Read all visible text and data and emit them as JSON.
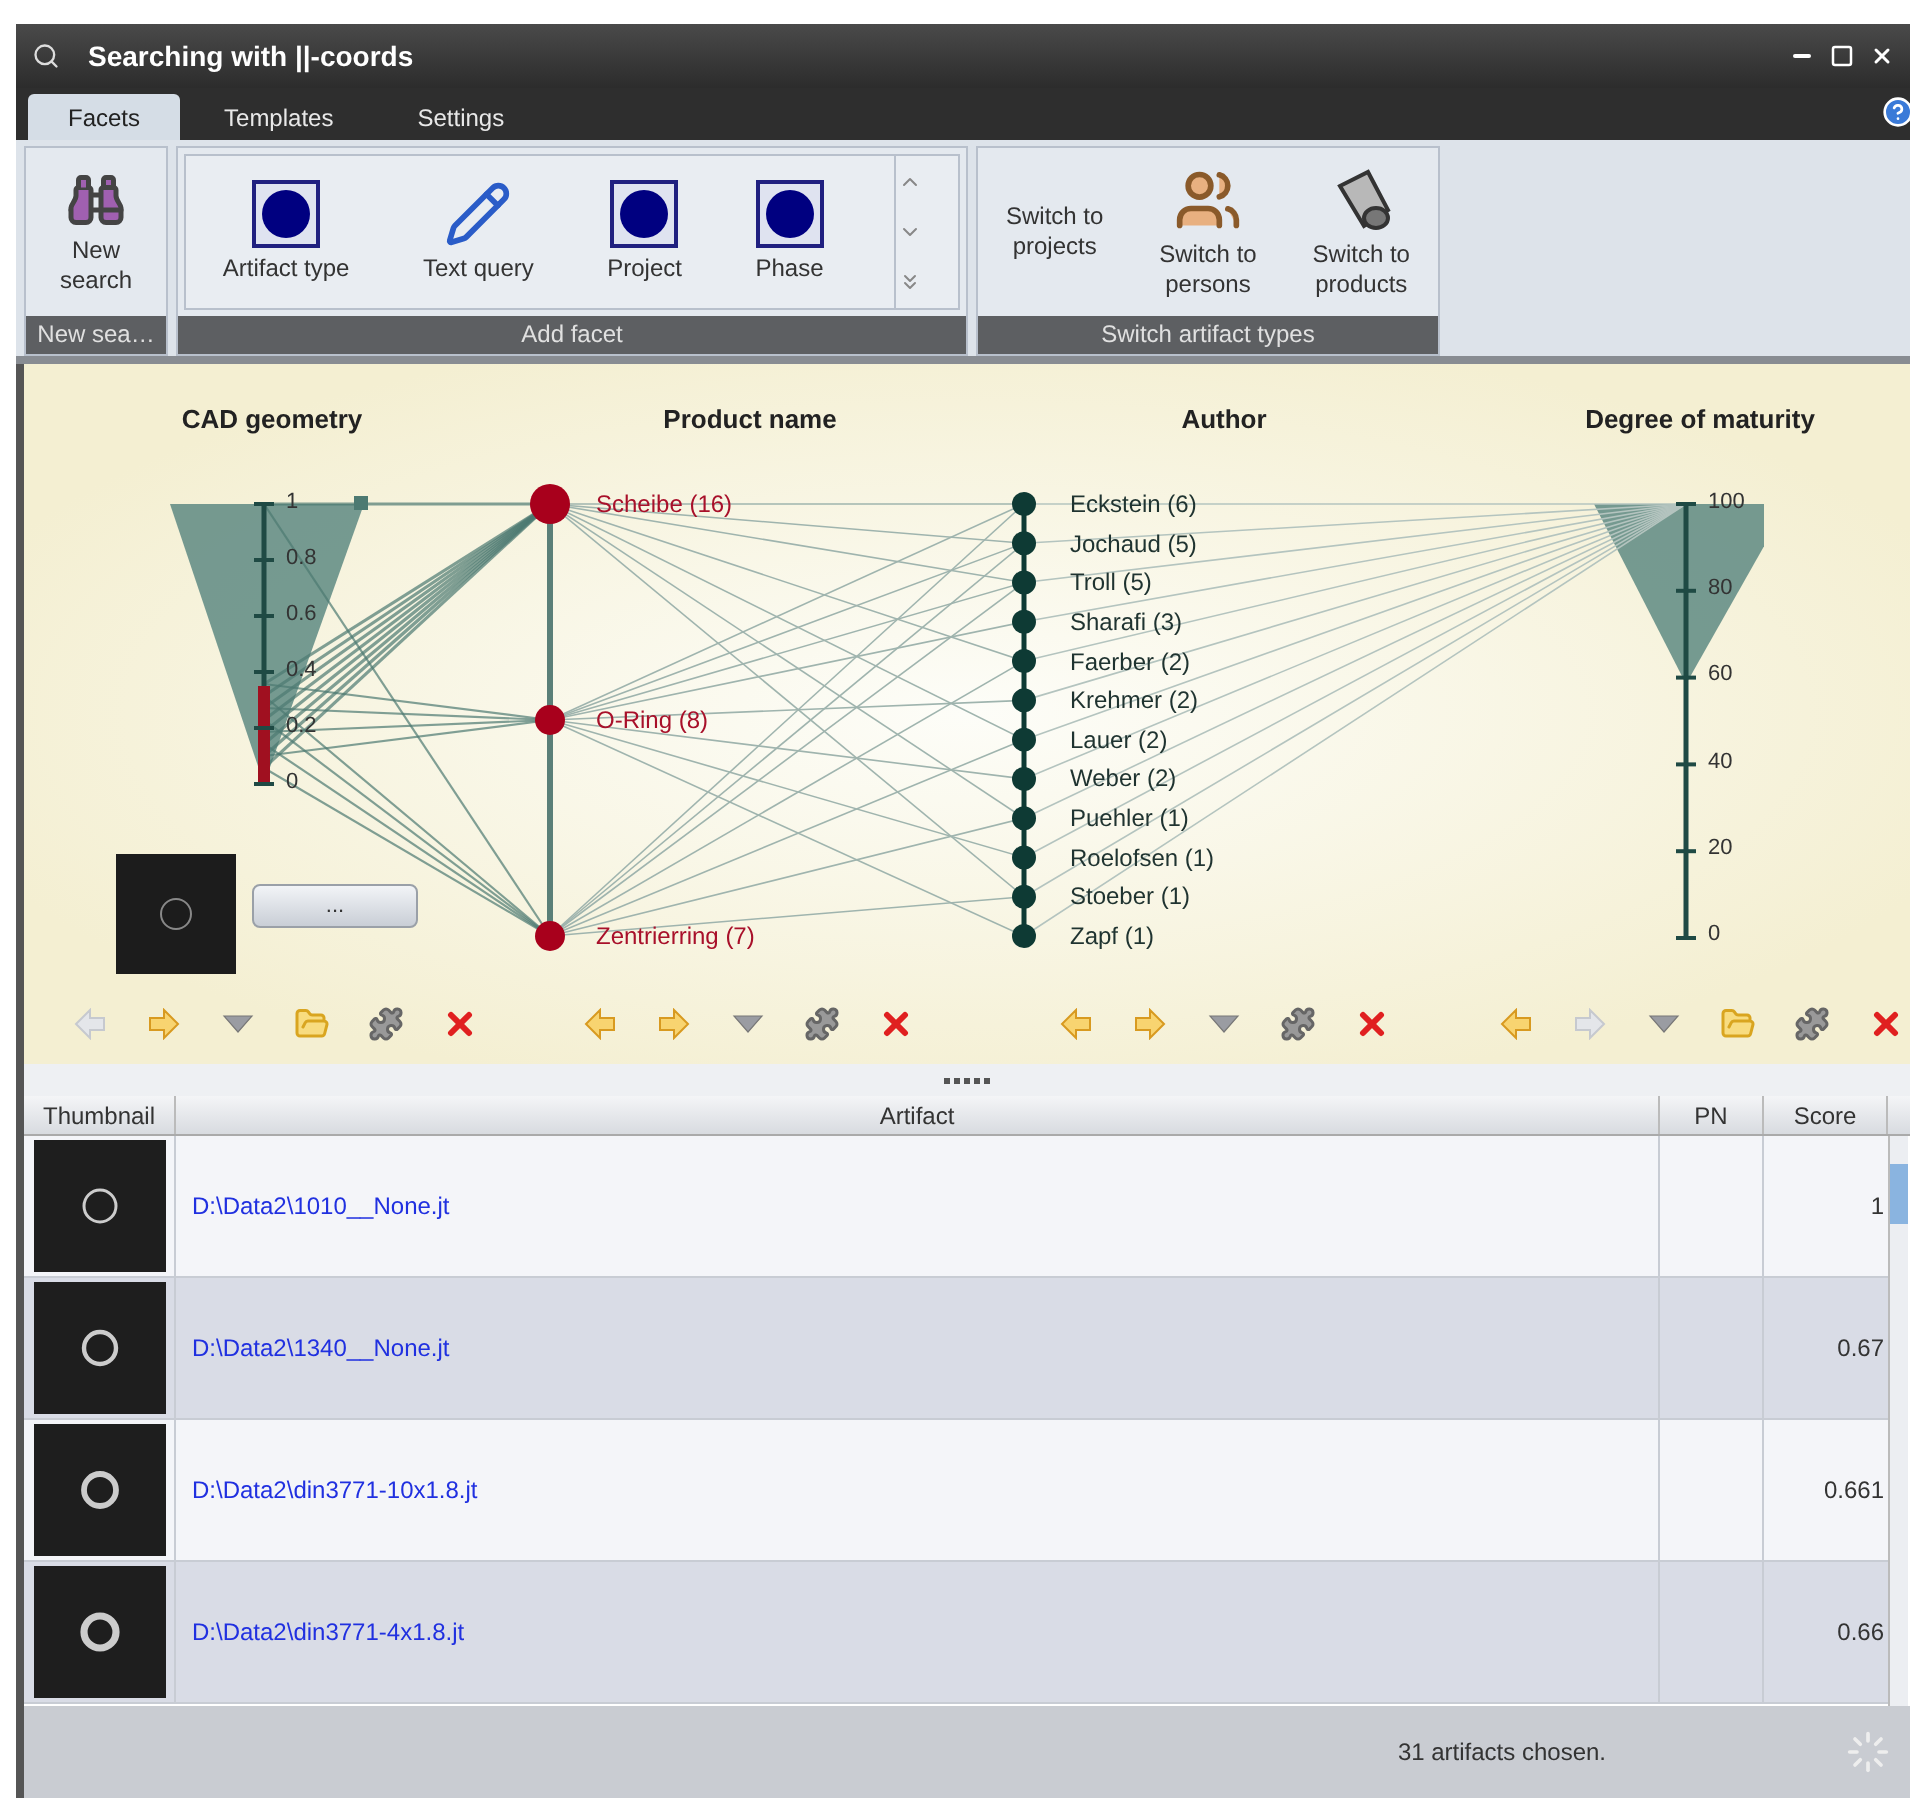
{
  "window": {
    "title": "Searching with ||-coords"
  },
  "tabs": [
    {
      "label": "Facets",
      "selected": true
    },
    {
      "label": "Templates",
      "selected": false
    },
    {
      "label": "Settings",
      "selected": false
    }
  ],
  "ribbon": {
    "groups": [
      {
        "label": "New sea…",
        "items": [
          {
            "label": "New search",
            "kind": "binoculars"
          }
        ]
      },
      {
        "label": "Add facet",
        "scroller": true,
        "items": [
          {
            "label": "Artifact type",
            "kind": "facet"
          },
          {
            "label": "Text query",
            "kind": "pencil"
          },
          {
            "label": "Project",
            "kind": "facet"
          },
          {
            "label": "Phase",
            "kind": "facet"
          }
        ]
      },
      {
        "label": "Switch artifact types",
        "items": [
          {
            "label": "Switch to projects",
            "kind": "plain"
          },
          {
            "label": "Switch to persons",
            "kind": "persons"
          },
          {
            "label": "Switch to products",
            "kind": "cone"
          }
        ]
      }
    ]
  },
  "axes": [
    {
      "title": "CAD geometry",
      "kind": "numeric",
      "ticks": [
        "1",
        "0.8",
        "0.6",
        "0.4",
        "0.2",
        "0"
      ],
      "preview_button": "...",
      "tools": [
        {
          "kind": "back",
          "disabled": true
        },
        {
          "kind": "forward",
          "disabled": false
        },
        {
          "kind": "menu",
          "disabled": false
        },
        {
          "kind": "folder",
          "disabled": false
        },
        {
          "kind": "puzzle",
          "disabled": false
        },
        {
          "kind": "remove",
          "disabled": false
        }
      ]
    },
    {
      "title": "Product name",
      "kind": "categorical",
      "values": [
        {
          "label": "Scheibe (16)",
          "selected": true
        },
        {
          "label": "O-Ring (8)",
          "selected": true
        },
        {
          "label": "Zentrierring (7)",
          "selected": true
        }
      ],
      "tools": [
        {
          "kind": "back",
          "disabled": false
        },
        {
          "kind": "forward",
          "disabled": false
        },
        {
          "kind": "menu",
          "disabled": false
        },
        {
          "kind": "puzzle",
          "disabled": false
        },
        {
          "kind": "remove",
          "disabled": false
        }
      ]
    },
    {
      "title": "Author",
      "kind": "categorical",
      "values": [
        {
          "label": "Eckstein (6)",
          "selected": false
        },
        {
          "label": "Jochaud (5)",
          "selected": false
        },
        {
          "label": "Troll (5)",
          "selected": false
        },
        {
          "label": "Sharafi (3)",
          "selected": false
        },
        {
          "label": "Faerber (2)",
          "selected": false
        },
        {
          "label": "Krehmer (2)",
          "selected": false
        },
        {
          "label": "Lauer (2)",
          "selected": false
        },
        {
          "label": "Weber (2)",
          "selected": false
        },
        {
          "label": "Puehler (1)",
          "selected": false
        },
        {
          "label": "Roelofsen (1)",
          "selected": false
        },
        {
          "label": "Stoeber (1)",
          "selected": false
        },
        {
          "label": "Zapf (1)",
          "selected": false
        }
      ],
      "tools": [
        {
          "kind": "back",
          "disabled": false
        },
        {
          "kind": "forward",
          "disabled": false
        },
        {
          "kind": "menu",
          "disabled": false
        },
        {
          "kind": "puzzle",
          "disabled": false
        },
        {
          "kind": "remove",
          "disabled": false
        }
      ]
    },
    {
      "title": "Degree of maturity",
      "kind": "numeric",
      "ticks": [
        "100",
        "80",
        "60",
        "40",
        "20",
        "0"
      ],
      "tools": [
        {
          "kind": "back",
          "disabled": false
        },
        {
          "kind": "forward",
          "disabled": true
        },
        {
          "kind": "menu",
          "disabled": false
        },
        {
          "kind": "folder",
          "disabled": false
        },
        {
          "kind": "puzzle",
          "disabled": false
        },
        {
          "kind": "remove",
          "disabled": false
        }
      ]
    }
  ],
  "table": {
    "columns": [
      "Thumbnail",
      "Artifact",
      "PN",
      "Score"
    ],
    "rows": [
      {
        "artifact": "D:\\Data2\\1010__None.jt",
        "score": "1"
      },
      {
        "artifact": "D:\\Data2\\1340__None.jt",
        "score": "0.67"
      },
      {
        "artifact": "D:\\Data2\\din3771-10x1.8.jt",
        "score": "0.661"
      },
      {
        "artifact": "D:\\Data2\\din3771-4x1.8.jt",
        "score": "0.66"
      }
    ]
  },
  "status_bar": {
    "text": "31 artifacts chosen."
  }
}
